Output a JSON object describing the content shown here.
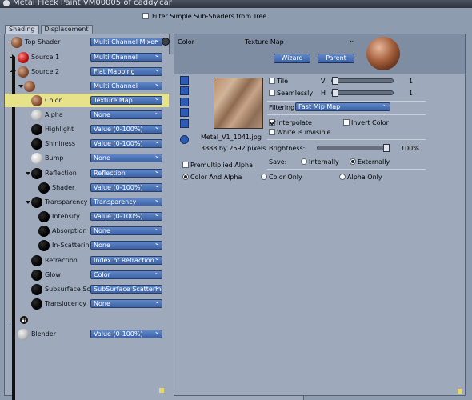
{
  "window": {
    "title": "Metal Fleck Paint VM00005 of caddy.car"
  },
  "filter": {
    "label": "Filter Simple Sub-Shaders from Tree",
    "checked": false
  },
  "tabs": [
    {
      "label": "Shading",
      "active": true
    },
    {
      "label": "Displacement",
      "active": false
    }
  ],
  "tree": {
    "top_shader": {
      "label": "Top Shader",
      "value": "Multi Channel Mixer"
    },
    "source1": {
      "label": "Source 1",
      "value": "Multi Channel"
    },
    "source2": {
      "label": "Source 2",
      "value": "Flat Mapping"
    },
    "unnamed": {
      "label": "",
      "value": "Multi Channel"
    },
    "color": {
      "label": "Color",
      "value": "Texture Map"
    },
    "alpha": {
      "label": "Alpha",
      "value": "None"
    },
    "highlight": {
      "label": "Highlight",
      "value": "Value (0-100%)"
    },
    "shininess": {
      "label": "Shininess",
      "value": "Value (0-100%)"
    },
    "bump": {
      "label": "Bump",
      "value": "None"
    },
    "reflection": {
      "label": "Reflection",
      "value": "Reflection"
    },
    "shader": {
      "label": "Shader",
      "value": "Value (0-100%)"
    },
    "transparency": {
      "label": "Transparency",
      "value": "Transparency"
    },
    "intensity": {
      "label": "Intensity",
      "value": "Value (0-100%)"
    },
    "absorption": {
      "label": "Absorption",
      "value": "None"
    },
    "inscattering": {
      "label": "In-Scattering",
      "value": "None"
    },
    "refraction": {
      "label": "Refraction",
      "value": "Index of Refraction"
    },
    "glow": {
      "label": "Glow",
      "value": "Color"
    },
    "subsurface": {
      "label": "Subsurface Sc",
      "value": "SubSurface Scattering"
    },
    "translucency": {
      "label": "Translucency",
      "value": "None"
    },
    "blender": {
      "label": "Blender",
      "value": "Value (0-100%)"
    }
  },
  "editor": {
    "channel": "Color",
    "type": "Texture Map",
    "wizard": "Wizard",
    "parent": "Parent",
    "filename": "Metal_V1_1041.jpg",
    "dimensions": "3888 by 2592 pixels",
    "tile": {
      "label": "Tile",
      "axis": "V",
      "value": "1",
      "checked": false
    },
    "seamless": {
      "label": "Seamlessly",
      "axis": "H",
      "value": "1",
      "checked": false
    },
    "filtering_label": "Filtering:",
    "filtering_value": "Fast Mip Map",
    "interpolate": {
      "label": "Interpolate",
      "checked": true
    },
    "invert": {
      "label": "Invert Color",
      "checked": false
    },
    "white_invisible": {
      "label": "White is invisible",
      "checked": false
    },
    "brightness_label": "Brightness:",
    "brightness_value": "100%",
    "brightness_fraction": 1.0,
    "save_label": "Save:",
    "save_internally": "Internally",
    "save_externally": "Externally",
    "save_selected": "Externally",
    "premultiplied": {
      "label": "Premultiplied Alpha",
      "checked": false
    },
    "mode_color_alpha": "Color And Alpha",
    "mode_color_only": "Color Only",
    "mode_alpha_only": "Alpha Only",
    "mode_selected": "Color And Alpha"
  }
}
